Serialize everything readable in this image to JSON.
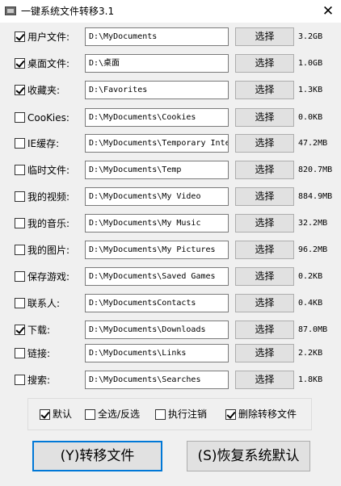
{
  "window": {
    "title": "一键系统文件转移3.1",
    "close_glyph": "✕"
  },
  "choose_label": "选择",
  "rows": [
    {
      "checked": true,
      "label": "用户文件:",
      "path": "D:\\MyDocuments",
      "size": "3.2GB"
    },
    {
      "checked": true,
      "label": "桌面文件:",
      "path": "D:\\桌面",
      "size": "1.0GB"
    },
    {
      "checked": true,
      "label": "收藏夹:",
      "path": "D:\\Favorites",
      "size": "1.3KB"
    },
    {
      "checked": false,
      "label": "CooKies:",
      "path": "D:\\MyDocuments\\Cookies",
      "size": "0.0KB"
    },
    {
      "checked": false,
      "label": "IE缓存:",
      "path": "D:\\MyDocuments\\Temporary Inte",
      "size": "47.2MB"
    },
    {
      "checked": false,
      "label": "临时文件:",
      "path": "D:\\MyDocuments\\Temp",
      "size": "820.7MB"
    },
    {
      "checked": false,
      "label": "我的视频:",
      "path": "D:\\MyDocuments\\My Video",
      "size": "884.9MB"
    },
    {
      "checked": false,
      "label": "我的音乐:",
      "path": "D:\\MyDocuments\\My Music",
      "size": "32.2MB"
    },
    {
      "checked": false,
      "label": "我的图片:",
      "path": "D:\\MyDocuments\\My Pictures",
      "size": "96.2MB"
    },
    {
      "checked": false,
      "label": "保存游戏:",
      "path": "D:\\MyDocuments\\Saved Games",
      "size": "0.2KB"
    },
    {
      "checked": false,
      "label": "联系人:",
      "path": "D:\\MyDocumentsContacts",
      "size": "0.4KB"
    },
    {
      "checked": true,
      "label": "下载:",
      "path": "D:\\MyDocuments\\Downloads",
      "size": "87.0MB"
    },
    {
      "checked": false,
      "label": "链接:",
      "path": "D:\\MyDocuments\\Links",
      "size": "2.2KB"
    },
    {
      "checked": false,
      "label": "搜索:",
      "path": "D:\\MyDocuments\\Searches",
      "size": "1.8KB"
    }
  ],
  "options": [
    {
      "checked": true,
      "label": "默认"
    },
    {
      "checked": false,
      "label": "全选/反选"
    },
    {
      "checked": false,
      "label": "执行注销"
    },
    {
      "checked": true,
      "label": "删除转移文件"
    }
  ],
  "buttons": {
    "transfer": "(Y)转移文件",
    "restore": "(S)恢复系统默认"
  }
}
